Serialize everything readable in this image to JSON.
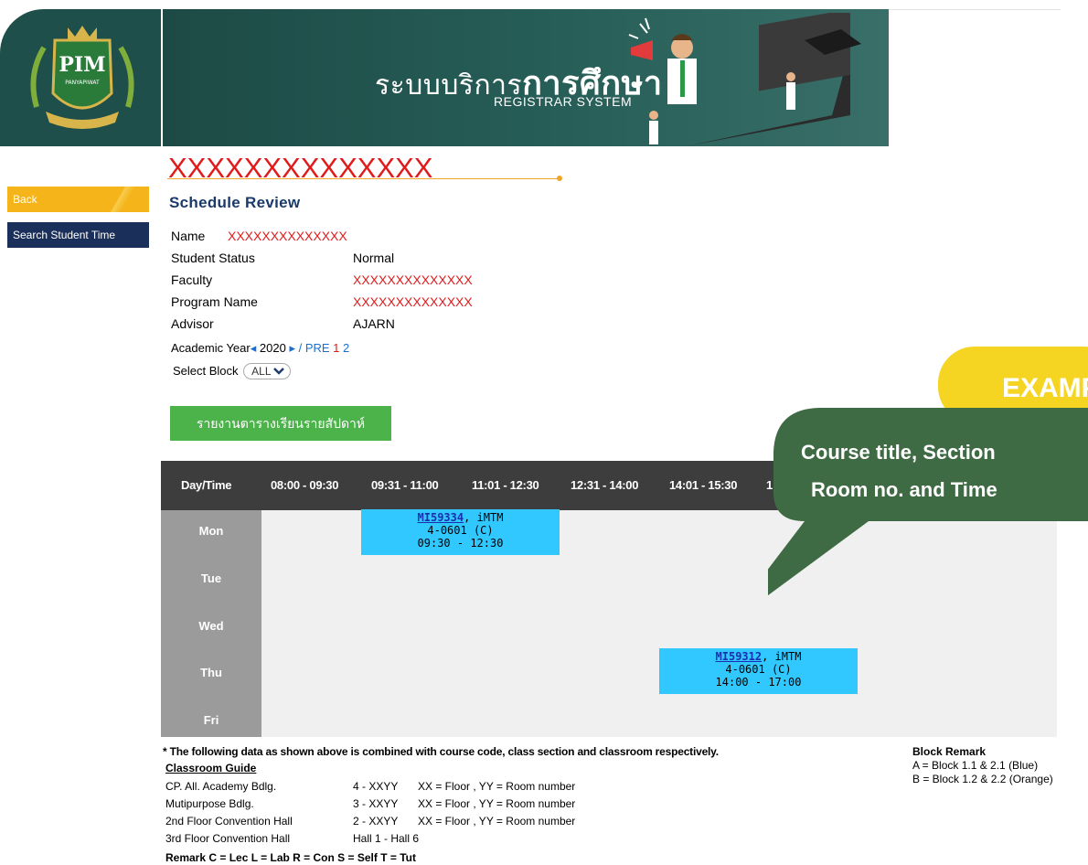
{
  "header": {
    "logo_text": "PIM",
    "logo_sub": "PANYAPIWAT",
    "title_th_prefix": "ระบบบริการ",
    "title_th_bold": "การศึกษา",
    "title_en": "REGISTRAR SYSTEM"
  },
  "sidebar": {
    "back_label": "Back",
    "search_label": "Search Student Time"
  },
  "profile": {
    "masked_title": "XXXXXXXXXXXXXX",
    "section_title": "Schedule Review",
    "name_label": "Name",
    "name_value": "XXXXXXXXXXXXXX",
    "status_label": "Student Status",
    "status_value": "Normal",
    "faculty_label": "Faculty",
    "faculty_value": "XXXXXXXXXXXXXX",
    "program_label": "Program Name",
    "program_value": "XXXXXXXXXXXXXX",
    "advisor_label": "Advisor",
    "advisor_value": "AJARN",
    "academic_year_label": "Academic Year",
    "academic_year_value": "2020",
    "prev_glyph": "◂",
    "next_glyph": "▸",
    "sep": " / ",
    "term_pre": "PRE",
    "term_1": "1",
    "term_2": "2",
    "select_block_label": "Select Block",
    "select_block_value": "ALL"
  },
  "report_button": "รายงานตารางเรียนรายสัปดาห์",
  "timetable": {
    "header": [
      "Day/Time",
      "08:00 - 09:30",
      "09:31 - 11:00",
      "11:01 - 12:30",
      "12:31 - 14:00",
      "14:01 - 15:30",
      "1"
    ],
    "days": [
      "Mon",
      "Tue",
      "Wed",
      "Thu",
      "Fri"
    ],
    "classes": [
      {
        "code": "MI59334",
        "program": ", iMTM",
        "room": "4-0601 (C)",
        "time": "09:30 - 12:30"
      },
      {
        "code": "MI59312",
        "program": ", iMTM",
        "room": "4-0601 (C)",
        "time": "14:00 - 17:00"
      }
    ]
  },
  "callout": {
    "line1": "Course title, Section",
    "line2": "Room no. and Time",
    "tag": "EXAMP"
  },
  "notes": {
    "main": "* The following data as shown above is combined with course code, class section and classroom respectively.",
    "guide_title": "Classroom Guide",
    "guide_rows": [
      [
        "CP. All. Academy Bdlg.",
        "4 - XXYY",
        "XX = Floor , YY = Room number"
      ],
      [
        "Mutipurpose Bdlg.",
        "3 - XXYY",
        "XX = Floor , YY = Room number"
      ],
      [
        "2nd Floor Convention Hall",
        "2 - XXYY",
        "XX = Floor , YY = Room number"
      ],
      [
        "3rd Floor Convention Hall",
        "Hall 1 - Hall 6",
        ""
      ]
    ],
    "remark": "Remark  C = Lec  L = Lab  R = Con  S = Self  T = Tut",
    "block_remark_title": "Block Remark",
    "block_remark_a": "A = Block 1.1 & 2.1 (Blue)",
    "block_remark_b": "B = Block 1.2 & 2.2 (Orange)"
  },
  "colors": {
    "header_bg": "#1f4f4a",
    "masked_red": "#e11b1b",
    "accent_orange": "#f0a42a",
    "back_yellow": "#f4b41a",
    "nav_navy": "#1a2f5a",
    "report_green": "#4cb24a",
    "table_header": "#3d3d3d",
    "day_column": "#9b9b9b",
    "class_cell": "#30c8ff",
    "callout_green": "#3f6b44",
    "example_yellow": "#f5d521"
  }
}
